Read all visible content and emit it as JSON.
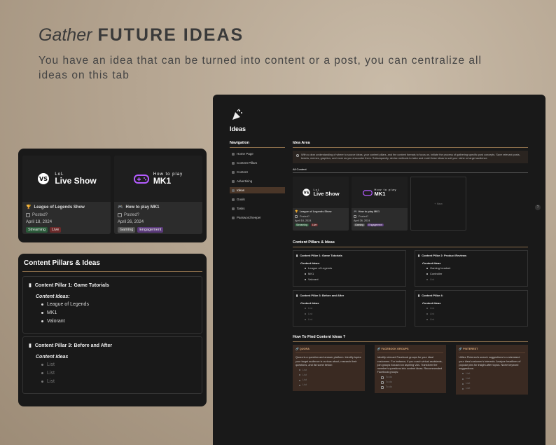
{
  "hero": {
    "title_light": "Gather",
    "title_bold": "FUTURE IDEAS",
    "subtitle": "You have an idea that can be turned into content or a post, you can centralize all ideas on this tab"
  },
  "colors": {
    "accent": "#8a6d4a",
    "panel": "#191919",
    "card": "#2c2c2c"
  },
  "gallery": [
    {
      "cover_small": "LoL",
      "cover_big": "Live Show",
      "icon": "trophy-icon",
      "title": "League of Legends Show",
      "posted_label": "Posted?",
      "date": "April 18, 2024",
      "tags": [
        "Streaming",
        "Live"
      ]
    },
    {
      "cover_small": "How to play",
      "cover_big": "MK1",
      "icon": "gamepad-icon",
      "title": "How to play MK1",
      "posted_label": "Posted?",
      "date": "April 26, 2024",
      "tags": [
        "Gaming",
        "Engagement"
      ]
    }
  ],
  "pillars_panel": {
    "title": "Content Pillars & Ideas",
    "pillar1": {
      "title": "Content Pillar 1: Game Tutorials",
      "sub": "Content Ideas:",
      "items": [
        "League of Legends",
        "MK1",
        "Valorant"
      ]
    },
    "pillar3": {
      "title": "Content Pillar 3: Before and After",
      "sub": "Content Ideas",
      "items": [
        "List",
        "List",
        "List"
      ]
    }
  },
  "app": {
    "title": "Ideas",
    "nav": {
      "title": "Navigation",
      "items": [
        "Home Page",
        "Content Pillars",
        "Content",
        "Advertising",
        "Ideas",
        "Goals",
        "Tasks",
        "Password keeper"
      ]
    },
    "idea_area": {
      "title": "Idea Area",
      "callout": "With a clear understanding of where to source ideas, your content pillars, and the content formats to focus on, initiate the process of gathering specific post concepts. Save relevant posts, tweets, memes, graphics, and more as you encounter them. Subsequently, devise methods to tailor and mold these ideas to suit your niche or target audience.",
      "view_tab": "All Content",
      "new_label": "+ New"
    },
    "pillars": {
      "title": "Content Pillars & Ideas",
      "p1": {
        "title": "Content Pillar 1: Game Tutorials",
        "sub": "Content Ideas:",
        "items": [
          "League of Legends",
          "MK1",
          "Valorant"
        ]
      },
      "p2": {
        "title": "Content Pillar 2: Product Reviews",
        "sub": "Content Ideas",
        "items": [
          "Gaming headset",
          "Controller",
          "List"
        ]
      },
      "p3": {
        "title": "Content Pillar 3: Before and After",
        "sub": "Content Ideas",
        "items": [
          "List",
          "List",
          "List"
        ]
      },
      "p4": {
        "title": "Content Pillar 4:",
        "sub": "Content Ideas",
        "items": [
          "List",
          "List",
          "List"
        ]
      }
    },
    "find": {
      "title": "How To Find Content Ideas ?",
      "quora": {
        "head": "QUORA",
        "text": "Quora is a question and answer platform. Identify topics your target audience is curious about, research their questions, and list some below:",
        "items": [
          "List",
          "List",
          "List",
          "List"
        ]
      },
      "facebook": {
        "head": "FACEBOOK GROUPS",
        "text": "Identify relevant Facebook groups for your ideal customers. For instance, if you coach virtual assistants, join groups focused on aspiring VAs. Transform the member's questions into content ideas. Recommended Facebook groups:",
        "items": [
          "To do",
          "To do",
          "To do"
        ]
      },
      "pinterest": {
        "head": "PINTEREST",
        "text": "Utilize Pinterest's search suggestions to understand your ideal customer's interests. Analyze headlines of popular pins for insight-after topics. Niche keyword suggestions:",
        "items": [
          "List",
          "List",
          "List",
          "List"
        ]
      }
    },
    "help_label": "?"
  }
}
